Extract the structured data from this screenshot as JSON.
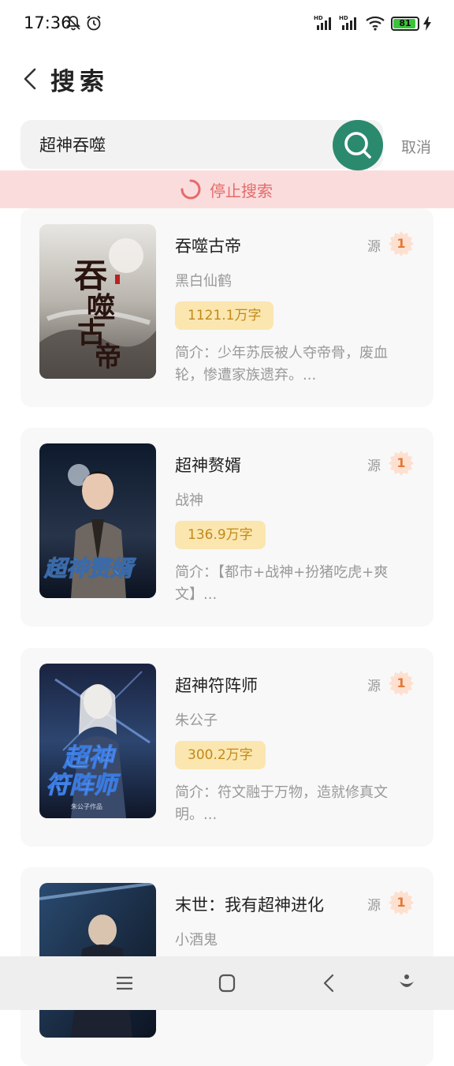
{
  "status_bar": {
    "time": "17:36",
    "battery": "81",
    "icons": [
      "mute-bell-icon",
      "alarm-icon",
      "hd-signal-icon",
      "hd-signal-icon",
      "wifi-icon",
      "battery-icon",
      "charging-icon"
    ]
  },
  "header": {
    "title": "搜索",
    "back_icon": "chevron-left-icon"
  },
  "search": {
    "query": "超神吞噬",
    "search_icon": "search-icon",
    "cancel_label": "取消"
  },
  "stop_bar": {
    "label": "停止搜索",
    "icon": "loading-spinner-icon"
  },
  "results": [
    {
      "title": "吞噬古帝",
      "author": "黑白仙鹤",
      "words": "1121.1万字",
      "intro": "简介：少年苏辰被人夺帝骨，废血轮，惨遭家族遗弃。...",
      "source_label": "源",
      "source_count": "1",
      "cover_text": "吞噬古帝"
    },
    {
      "title": "超神赘婿",
      "author": "战神",
      "words": "136.9万字",
      "intro": "简介：【都市+战神+扮猪吃虎+爽文】...",
      "source_label": "源",
      "source_count": "1",
      "cover_text": "超神赘婿"
    },
    {
      "title": "超神符阵师",
      "author": "朱公子",
      "words": "300.2万字",
      "intro": "简介：符文融于万物，造就修真文明。...",
      "source_label": "源",
      "source_count": "1",
      "cover_text": "超神符阵师"
    },
    {
      "title": "末世：我有超神进化",
      "author": "小酒鬼",
      "source_label": "源",
      "source_count": "1"
    }
  ],
  "nav_bar": {
    "buttons": [
      "menu-icon",
      "home-icon",
      "back-icon",
      "assistant-icon"
    ]
  },
  "colors": {
    "accent": "#2b8a6e",
    "stop_bg": "#fbdcdc",
    "stop_text": "#e46b6b",
    "badge_bg": "#fbe6b0",
    "badge_text": "#c08a1a"
  }
}
